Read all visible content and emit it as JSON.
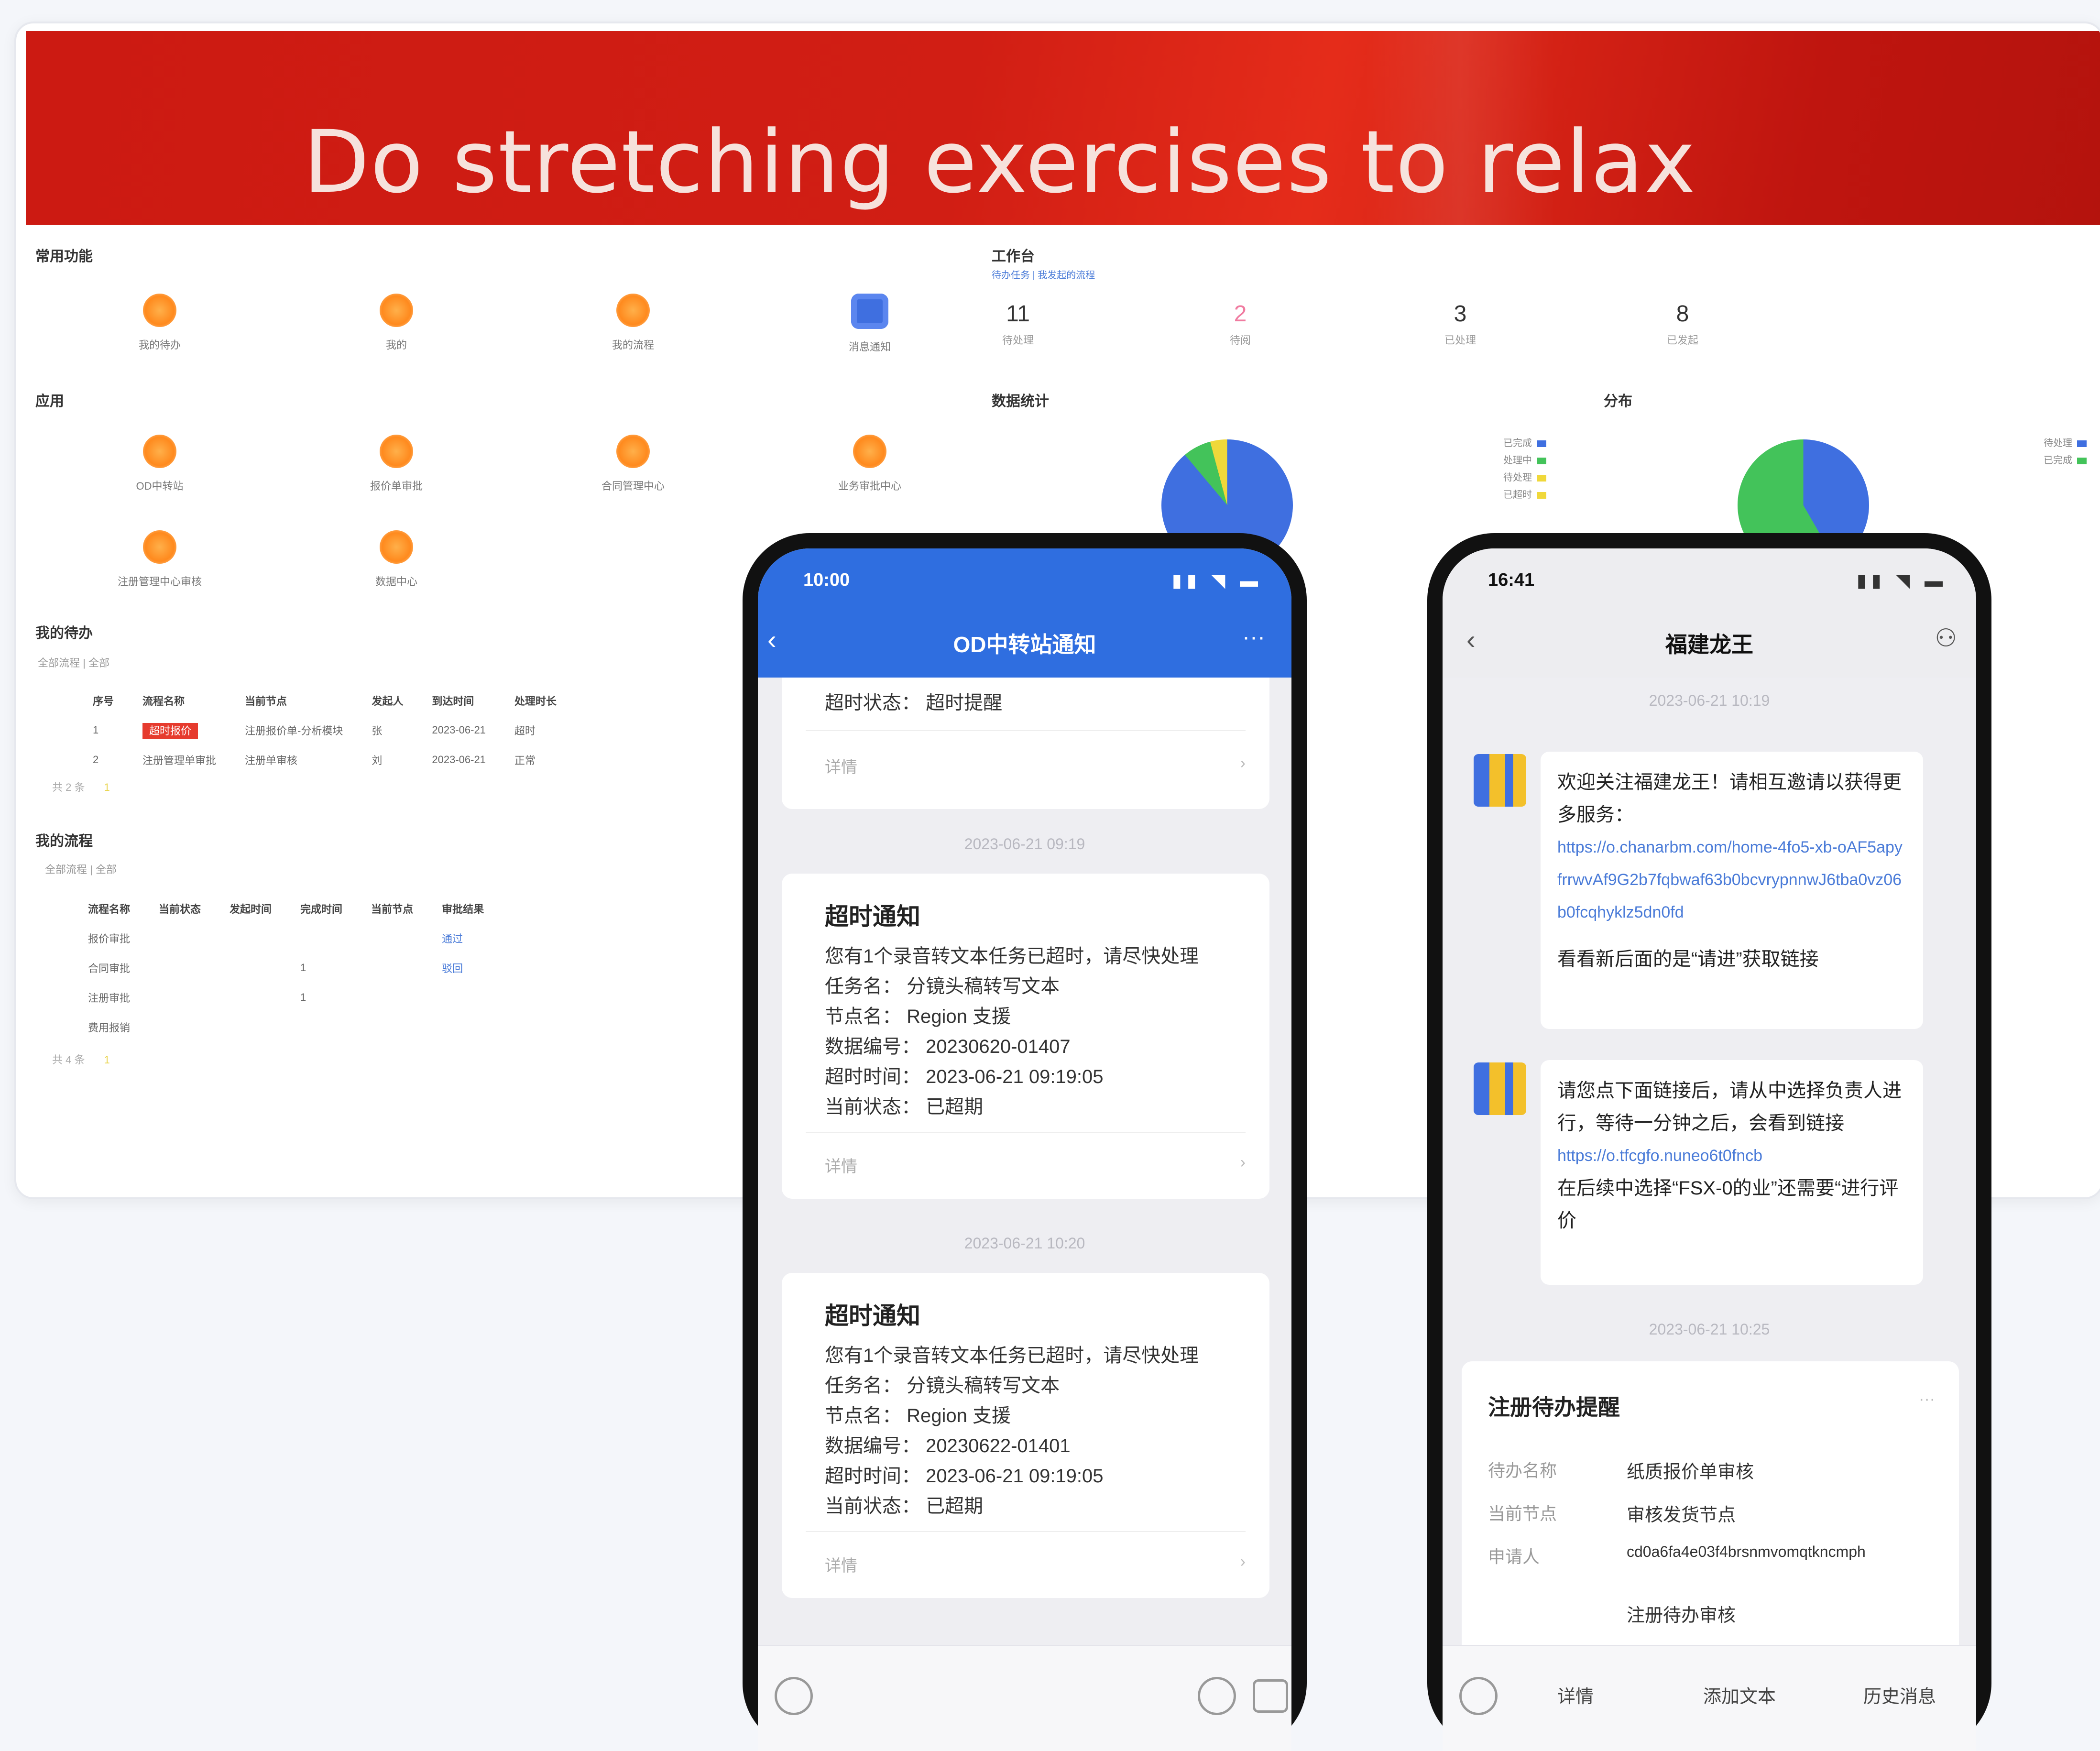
{
  "banner": {
    "title": "Do stretching exercises to relax"
  },
  "phone1": {
    "status_time": "10:00",
    "status_icons": "▮▮ ◥ ▬",
    "header_title": "OD中转站通知",
    "partial_row": "超时状态：  超时提醒",
    "partial_footer": "详情",
    "timestamp1": "2023-06-21 09:19",
    "timestamp2": "2023-06-21 10:20",
    "cards": [
      {
        "title": "超时通知",
        "rows": [
          "您有1个录音转文本任务已超时，请尽快处理",
          "任务名：  分镜头稿转写文本",
          "节点名：  Region 支援",
          "数据编号：  20230620-01407",
          "超时时间：  2023-06-21 09:19:05",
          "当前状态：  已超期"
        ],
        "footer": "详情"
      },
      {
        "title": "超时通知",
        "rows": [
          "您有1个录音转文本任务已超时，请尽快处理",
          "任务名：  分镜头稿转写文本",
          "节点名：  Region 支援",
          "数据编号：  20230622-01401",
          "超时时间：  2023-06-21 09:19:05",
          "当前状态：  已超期"
        ],
        "footer": "详情"
      }
    ]
  },
  "phone2": {
    "status_time": "16:41",
    "status_icons": "▮▮ ◥ ▬",
    "header_title": "福建龙王",
    "timestamp1": "2023-06-21 10:19",
    "timestamp2": "2023-06-21 10:25",
    "msg1_text": "欢迎关注福建龙王！请相互邀请以获得更多服务：",
    "msg1_link": "https://o.chanarbm.com/home-4fo5-xb-oAF5apyfrrwvAf9G2b7fqbwaf63b0bcvrypnnwJ6tba0vz06b0fcqhyklz5dn0fd",
    "msg1_tail": "看看新后面的是“请进”获取链接",
    "msg2_text": "请您点下面链接后，请从中选择负责人进行，等待一分钟之后，会看到链接",
    "msg2_link": "https://o.tfcgfo.nuneo6t0fncb",
    "msg2_tail": "在后续中选择“FSX-0的业”还需要“进行评价",
    "card": {
      "title": "注册待办提醒",
      "rows": [
        {
          "k": "待办名称",
          "v": "纸质报价单审核"
        },
        {
          "k": "当前节点",
          "v": "审核发货节点"
        },
        {
          "k": "申请人",
          "v": "cd0a6fa4e03f4brsnmvomqtkncmph"
        },
        {
          "k": "",
          "v": "注册待办审核"
        }
      ]
    },
    "tabs": [
      "详情",
      "添加文本",
      "历史消息"
    ]
  },
  "dashboard": {
    "s1_title": "常用功能",
    "s1_apps": [
      "我的待办",
      "我的",
      "我的流程",
      "消息通知"
    ],
    "stats_title": "工作台",
    "stats_sub": "待办任务  |  我发起的流程",
    "stats": [
      {
        "num": "11",
        "cap": "待处理"
      },
      {
        "num": "2",
        "cap": "待阅"
      },
      {
        "num": "3",
        "cap": "已处理"
      },
      {
        "num": "8",
        "cap": "已发起"
      }
    ],
    "s2_title": "应用",
    "s2_apps": [
      "OD中转站",
      "报价单审批",
      "合同管理中心",
      "业务审批中心",
      "注册管理中心审核",
      "数据中心"
    ],
    "pie1_title": "数据统计",
    "pie2_title": "分布",
    "legend1": [
      "已完成",
      "处理中",
      "待处理",
      "已超时"
    ],
    "legend1_colors": [
      "#3f6fe0",
      "#43c35a",
      "#f0d83a",
      "#aaaaaa"
    ],
    "legend2": [
      "待处理",
      "已完成"
    ],
    "legend2_colors": [
      "#3f6fe0",
      "#43c35a"
    ],
    "t1_title": "我的待办",
    "t1_filter": "全部流程  |  全部",
    "t1_headers": [
      "序号",
      "流程名称",
      "当前节点",
      "发起人",
      "到达时间",
      "处理时长"
    ],
    "t1_rows": [
      [
        "1",
        "超时报价",
        "注册报价单-分析模块",
        "张",
        "2023-06-21",
        "超时"
      ],
      [
        "2",
        "注册管理单审批",
        "注册单审核",
        "刘",
        "2023-06-21",
        "正常"
      ]
    ],
    "t1_pager": "共 2 条",
    "t2_title": "我的流程",
    "t2_filter": "全部流程  |  全部",
    "t2_headers": [
      "流程名称",
      "当前状态",
      "发起时间",
      "完成时间",
      "当前节点",
      "审批结果"
    ],
    "t2_rows": [
      [
        "报价审批",
        "",
        "",
        "",
        "",
        "通过"
      ],
      [
        "合同审批",
        "",
        "",
        "1",
        "",
        "驳回"
      ],
      [
        "注册审批",
        "",
        "",
        "1",
        "",
        ""
      ],
      [
        "费用报销",
        "",
        "",
        "",
        "",
        ""
      ]
    ],
    "t2_pager": "共 4 条",
    "pager_page": "1"
  }
}
